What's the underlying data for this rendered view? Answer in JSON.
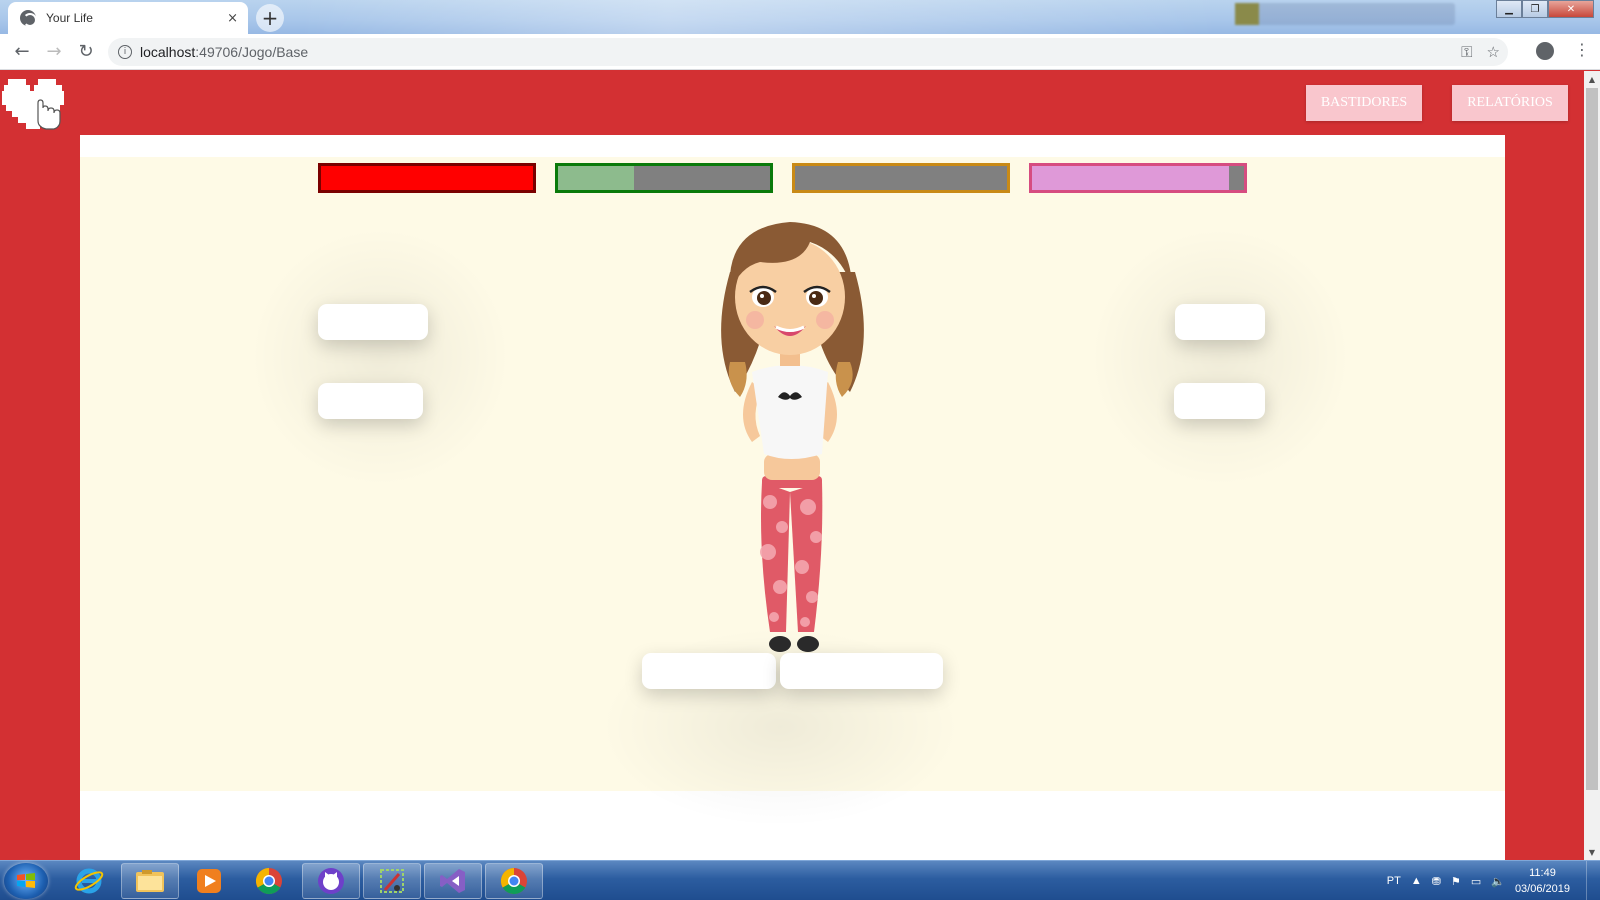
{
  "browser": {
    "tab_title": "Your Life",
    "tab_close": "×",
    "new_tab": "+",
    "url_host": "localhost",
    "url_path": ":49706/Jogo/Base"
  },
  "header": {
    "bastidores_label": "BASTIDORES",
    "relatorios_label": "RELATÓRIOS"
  },
  "status_bars": [
    {
      "name": "red",
      "border": "#7a0000",
      "fill": "#ff0000",
      "level": 1.0
    },
    {
      "name": "green",
      "border": "#0a7a0a",
      "fill": "#8dbb8d",
      "level": 0.36
    },
    {
      "name": "orange",
      "border": "#c98a16",
      "fill": "#d4a040",
      "level": 0.0
    },
    {
      "name": "pink",
      "border": "#d64c80",
      "fill": "#df99d8",
      "level": 0.93
    }
  ],
  "colors": {
    "page_background": "#d33033",
    "game_background": "#fefae6",
    "header_button": "#f9c6cd"
  },
  "taskbar": {
    "apps": [
      "start-orb",
      "internet-explorer",
      "file-explorer",
      "media-player",
      "chrome",
      "github-desktop",
      "snipping-tool",
      "visual-studio",
      "chrome-window"
    ],
    "language": "PT",
    "time": "11:49",
    "date": "03/06/2019"
  }
}
